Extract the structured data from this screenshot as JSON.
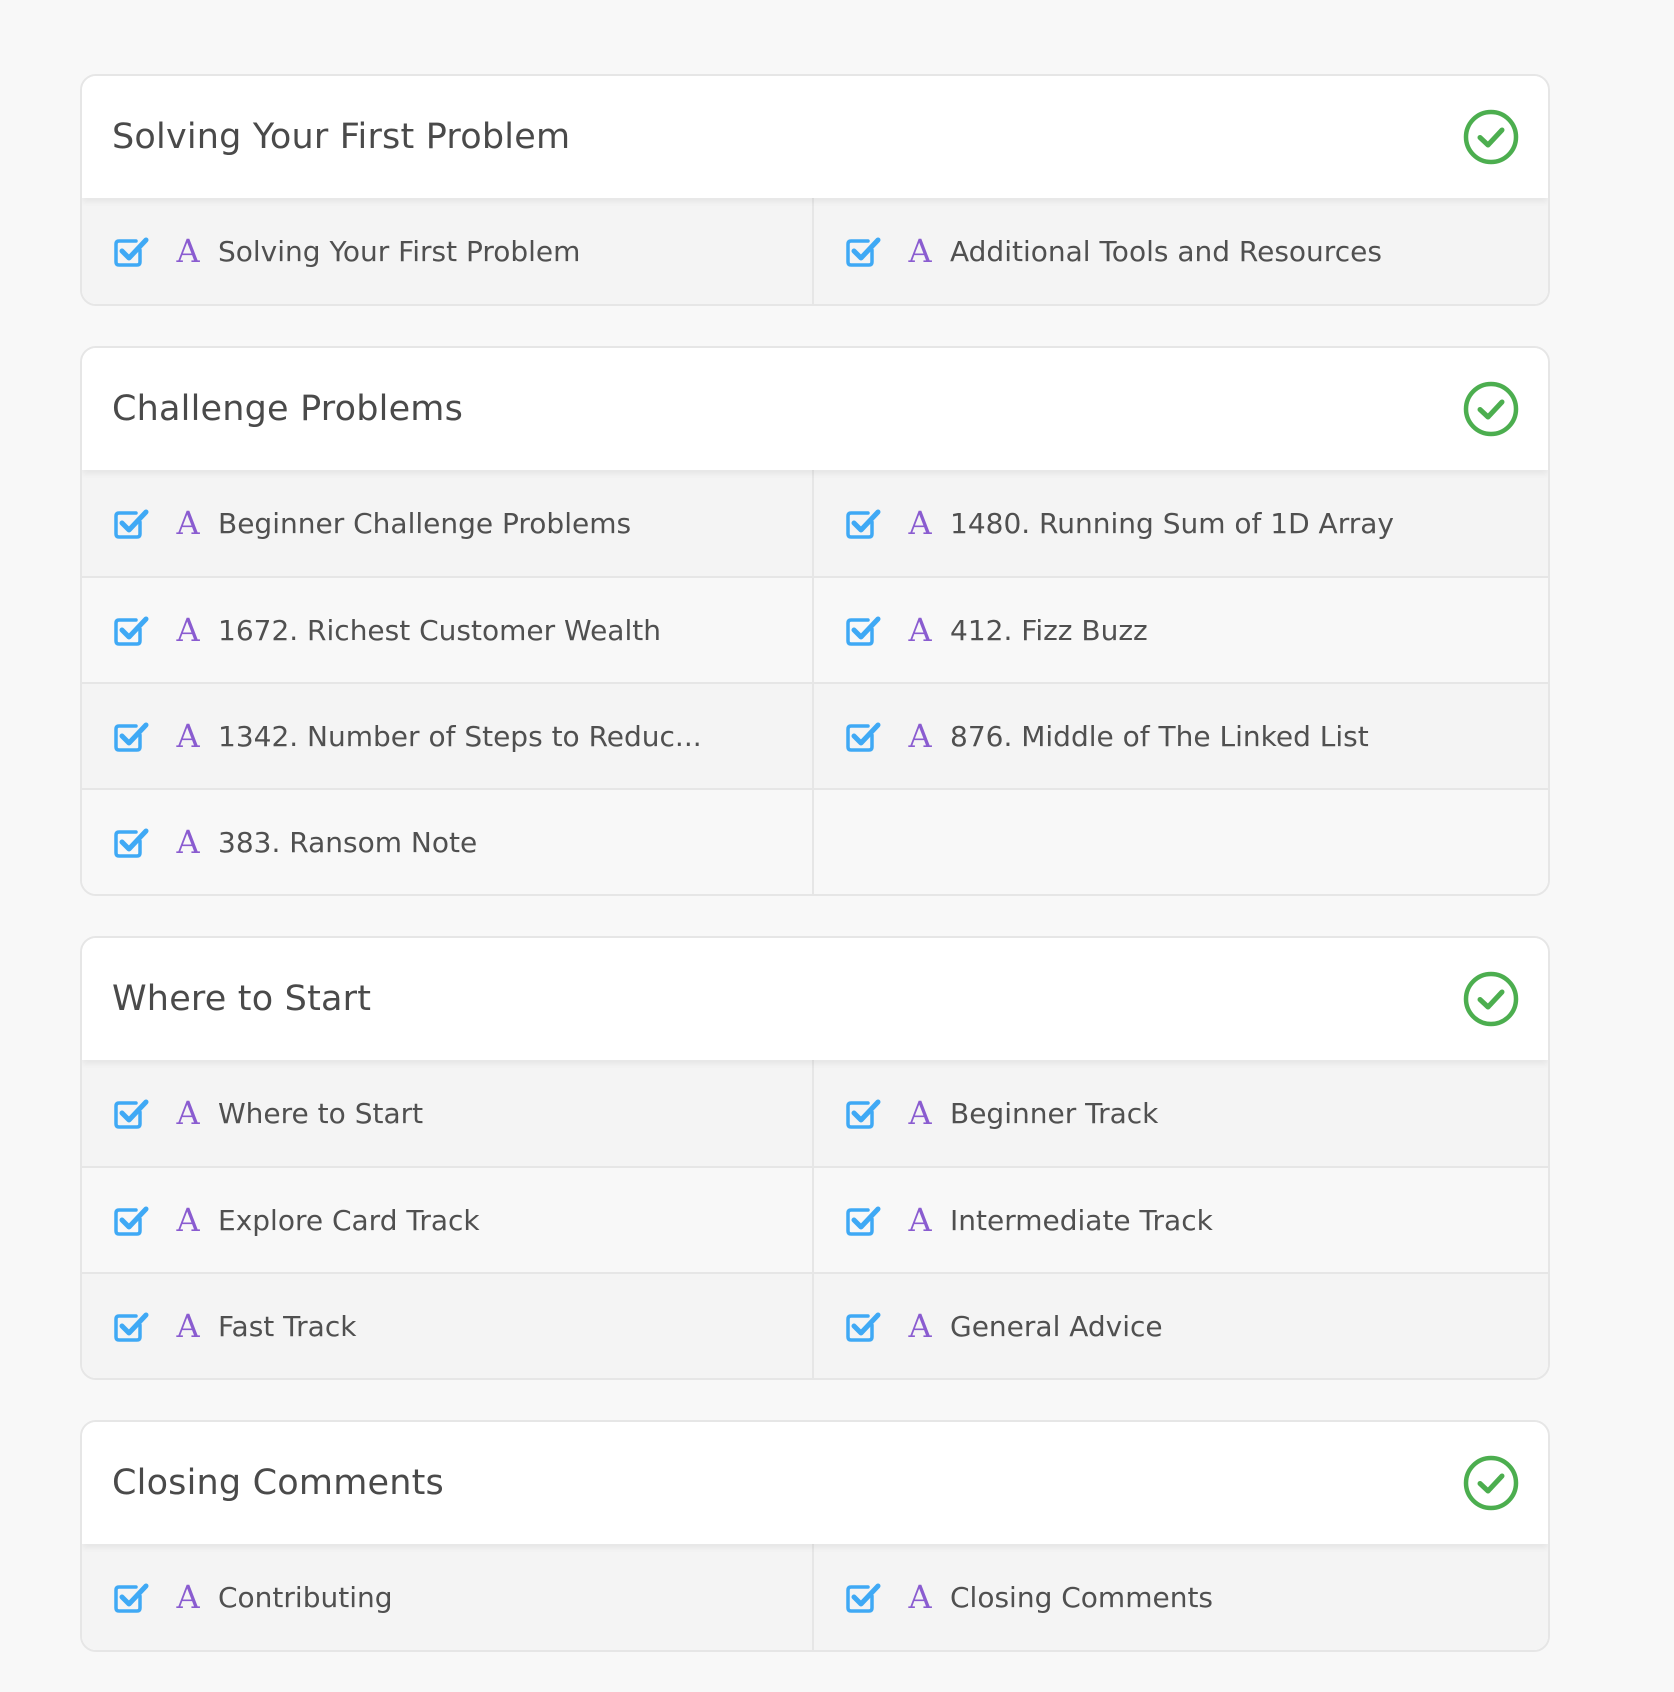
{
  "chapters": [
    {
      "title": "Solving Your First Problem",
      "items": [
        {
          "label": "Solving Your First Problem",
          "type_glyph": "A",
          "completed": true
        },
        {
          "label": "Additional Tools and Resources",
          "type_glyph": "A",
          "completed": true
        }
      ]
    },
    {
      "title": "Challenge Problems",
      "items": [
        {
          "label": "Beginner Challenge Problems",
          "type_glyph": "A",
          "completed": true
        },
        {
          "label": "1480. Running Sum of 1D Array",
          "type_glyph": "A",
          "completed": true
        },
        {
          "label": "1672. Richest Customer Wealth",
          "type_glyph": "A",
          "completed": true
        },
        {
          "label": "412. Fizz Buzz",
          "type_glyph": "A",
          "completed": true
        },
        {
          "label": "1342. Number of Steps to Reduc...",
          "type_glyph": "A",
          "completed": true
        },
        {
          "label": "876. Middle of The Linked List",
          "type_glyph": "A",
          "completed": true
        },
        {
          "label": "383. Ransom Note",
          "type_glyph": "A",
          "completed": true
        }
      ]
    },
    {
      "title": "Where to Start",
      "items": [
        {
          "label": "Where to Start",
          "type_glyph": "A",
          "completed": true
        },
        {
          "label": "Beginner Track",
          "type_glyph": "A",
          "completed": true
        },
        {
          "label": "Explore Card Track",
          "type_glyph": "A",
          "completed": true
        },
        {
          "label": "Intermediate Track",
          "type_glyph": "A",
          "completed": true
        },
        {
          "label": "Fast Track",
          "type_glyph": "A",
          "completed": true
        },
        {
          "label": "General Advice",
          "type_glyph": "A",
          "completed": true
        }
      ]
    },
    {
      "title": "Closing Comments",
      "items": [
        {
          "label": "Contributing",
          "type_glyph": "A",
          "completed": true
        },
        {
          "label": "Closing Comments",
          "type_glyph": "A",
          "completed": true
        }
      ]
    }
  ],
  "icons": {
    "chapter_done": "check-circle-icon",
    "item_done": "checkbox-checked-icon",
    "item_type": "article-type-icon"
  },
  "colors": {
    "done_green": "#4cae4f",
    "checkbox_blue": "#3fa9f5",
    "type_purple": "#8a5cd0",
    "title_text": "#4a4a4a",
    "item_text": "#505050",
    "border": "#e6e6e6"
  }
}
